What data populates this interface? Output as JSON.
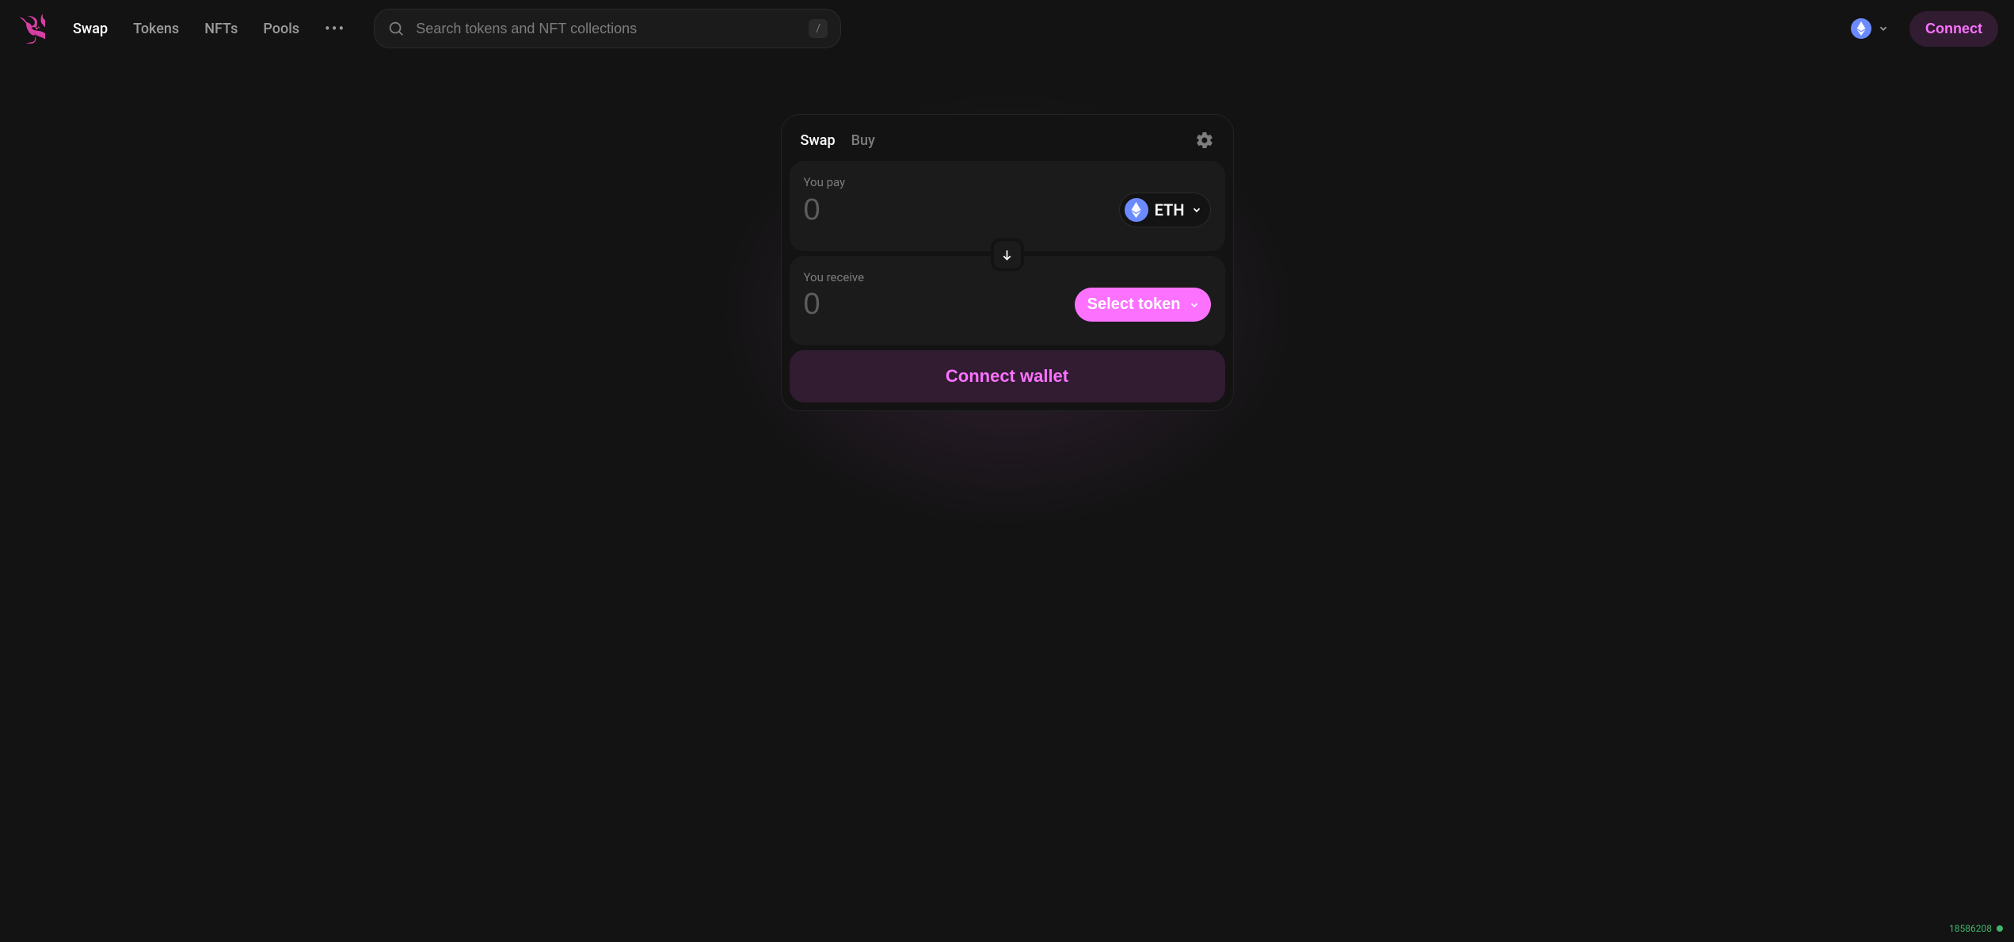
{
  "nav": {
    "links": {
      "swap": "Swap",
      "tokens": "Tokens",
      "nfts": "NFTs",
      "pools": "Pools"
    },
    "search_placeholder": "Search tokens and NFT collections",
    "search_kbd": "/",
    "connect_label": "Connect"
  },
  "swap": {
    "tabs": {
      "swap": "Swap",
      "buy": "Buy"
    },
    "pay_label": "You pay",
    "receive_label": "You receive",
    "amount_placeholder": "0",
    "pay_token": "ETH",
    "select_token_label": "Select token",
    "connect_wallet_label": "Connect wallet"
  },
  "footer": {
    "block_number": "18586208"
  },
  "colors": {
    "accent": "#fc72ff",
    "accent_bg": "#311c31",
    "eth_blue": "#6b8aff",
    "green": "#40b66b"
  }
}
